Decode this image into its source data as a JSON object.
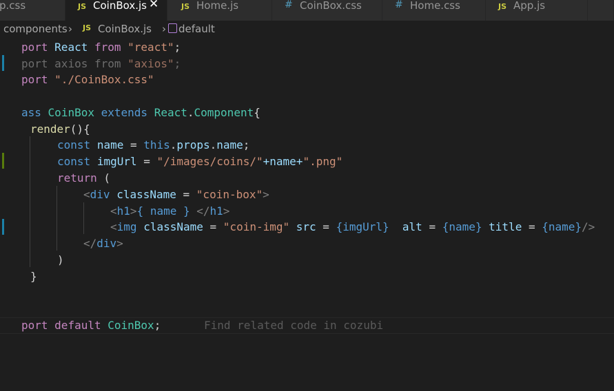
{
  "tabs": [
    {
      "icon": "JS",
      "label": "p.css"
    },
    {
      "icon": "JS",
      "label": "CoinBox.js",
      "close": "✕"
    },
    {
      "icon": "JS",
      "label": "Home.js"
    },
    {
      "icon": "#",
      "label": "CoinBox.css"
    },
    {
      "icon": "#",
      "label": "Home.css"
    },
    {
      "icon": "JS",
      "label": "App.js"
    }
  ],
  "breadcrumb": {
    "folder": "components",
    "sep1": "›",
    "file_icon": "JS",
    "file": "CoinBox.js",
    "sep2": "›",
    "symbol": "default"
  },
  "code": {
    "l1": [
      "port",
      "React",
      "from",
      "\"react\"",
      ";"
    ],
    "l2": [
      "port",
      "axios",
      "from",
      "\"axios\"",
      ";"
    ],
    "l3": [
      "port",
      "\"./CoinBox.css\""
    ],
    "l5": [
      "ass",
      "CoinBox",
      "extends",
      "React",
      ".",
      "Component",
      "{"
    ],
    "l6": [
      "render",
      "(){"
    ],
    "l7": [
      "const",
      "name",
      " = ",
      "this",
      ".",
      "props",
      ".",
      "name",
      ";"
    ],
    "l8": [
      "const",
      "imgUrl",
      " = ",
      "\"/images/coins/\"",
      "+name+",
      "\".png\""
    ],
    "l9": [
      "return",
      " ("
    ],
    "l10": [
      "<",
      "div",
      "className",
      " = ",
      "\"coin-box\"",
      ">"
    ],
    "l11": [
      "<",
      "h1",
      ">",
      "{ name }",
      "</",
      "h1",
      ">"
    ],
    "l12": [
      "<",
      "img",
      "className",
      " = ",
      "\"coin-img\"",
      "src",
      " = ",
      "{imgUrl}",
      "alt",
      " = ",
      "{name}",
      "title",
      " = ",
      "{name}",
      "/>"
    ],
    "l13": [
      "</",
      "div",
      ">"
    ],
    "l14": [
      ")"
    ],
    "l15": [
      "}"
    ],
    "l18": [
      "port",
      "default",
      "CoinBox",
      ";"
    ],
    "hint": "Find related code in cozubi"
  },
  "colors": {
    "background": "#1e1e1e",
    "keyword": "#569cd6",
    "control": "#c586c0",
    "string": "#ce9178",
    "variable": "#9cdcfe",
    "class": "#4ec9b0",
    "function": "#dcdcaa",
    "git_modified": "#1b81a8",
    "git_added": "#587c0c"
  }
}
